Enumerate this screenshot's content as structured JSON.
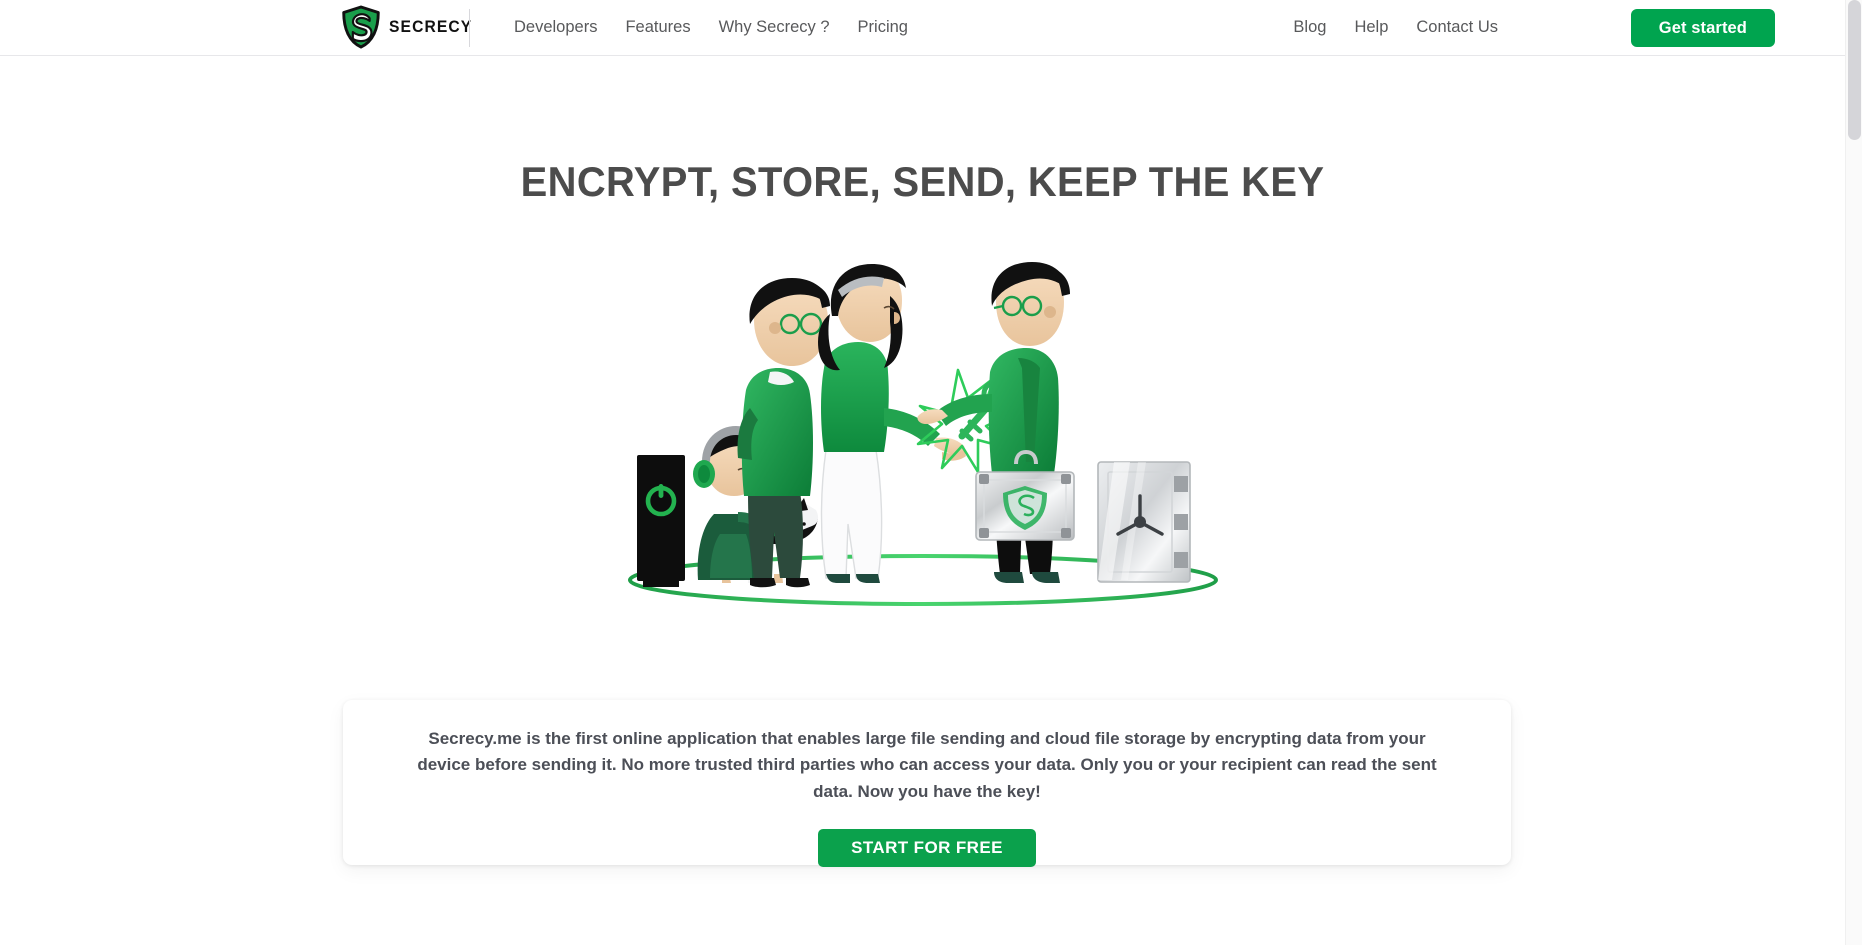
{
  "brand": {
    "name": "SECRECY",
    "logo_icon": "shield-s-logo",
    "shield_color": "#1a9e4b",
    "shield_outline": "#111111"
  },
  "header": {
    "nav_left": [
      {
        "label": "Developers",
        "name": "developers"
      },
      {
        "label": "Features",
        "name": "features"
      },
      {
        "label": "Why Secrecy ?",
        "name": "why-secrecy"
      },
      {
        "label": "Pricing",
        "name": "pricing"
      }
    ],
    "nav_right": [
      {
        "label": "Blog",
        "name": "blog"
      },
      {
        "label": "Help",
        "name": "help"
      },
      {
        "label": "Contact Us",
        "name": "contact-us"
      }
    ],
    "cta_label": "Get started",
    "cta_color": "#00a44f"
  },
  "hero": {
    "title": "ENCRYPT, STORE, SEND, KEEP THE KEY",
    "title_color": "#4c4c4c",
    "illustration": {
      "name": "people-exchanging-encryption-key",
      "accent_color": "#1a9e4b",
      "ground_ring_color": "#2fc254",
      "elements": [
        "server-tower-with-power-icon",
        "child-with-headphones",
        "dog-with-green-collar",
        "man-with-glasses-green-sweater",
        "woman-receiving-key",
        "green-key-with-sparkle",
        "man-handing-key-with-briefcase",
        "secrecy-shield-briefcase",
        "metal-safe-vault"
      ]
    }
  },
  "info_card": {
    "paragraph": "Secrecy.me is the first online application that enables large file sending and cloud file storage by encrypting data from your device before sending it. No more trusted third parties who can access your data. Only you or your recipient can read the sent data. Now you have the key!",
    "cta_label": "START FOR FREE",
    "cta_color": "#0ba14c"
  },
  "scrollbar": {
    "name": "page-scrollbar",
    "thumb_color": "#d5d5d9"
  }
}
